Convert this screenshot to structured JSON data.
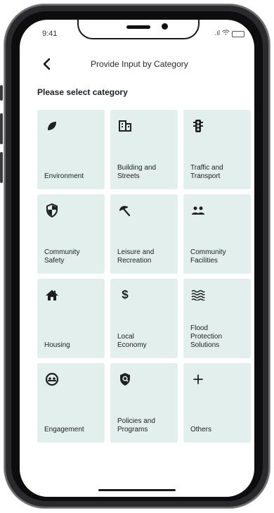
{
  "status_bar": {
    "time": "9:41"
  },
  "header": {
    "title": "Provide Input by Category"
  },
  "section": {
    "title": "Please select category"
  },
  "categories": [
    {
      "label": "Environment",
      "icon": "leaf-icon"
    },
    {
      "label": "Building and\nStreets",
      "icon": "building-icon"
    },
    {
      "label": "Traffic and\nTransport",
      "icon": "traffic-light-icon"
    },
    {
      "label": "Community\nSafety",
      "icon": "shield-icon"
    },
    {
      "label": "Leisure and\nRecreation",
      "icon": "umbrella-icon"
    },
    {
      "label": "Community\nFacilities",
      "icon": "people-icon"
    },
    {
      "label": "Housing",
      "icon": "house-icon"
    },
    {
      "label": "Local\nEconomy",
      "icon": "dollar-icon"
    },
    {
      "label": "Flood\nProtection\nSolutions",
      "icon": "waves-icon"
    },
    {
      "label": "Engagement",
      "icon": "engagement-icon"
    },
    {
      "label": "Policies and\nPrograms",
      "icon": "policy-shield-icon"
    },
    {
      "label": "Others",
      "icon": "plus-icon"
    }
  ],
  "colors": {
    "tile_background": "#e2efec",
    "text": "#1d1f21"
  }
}
